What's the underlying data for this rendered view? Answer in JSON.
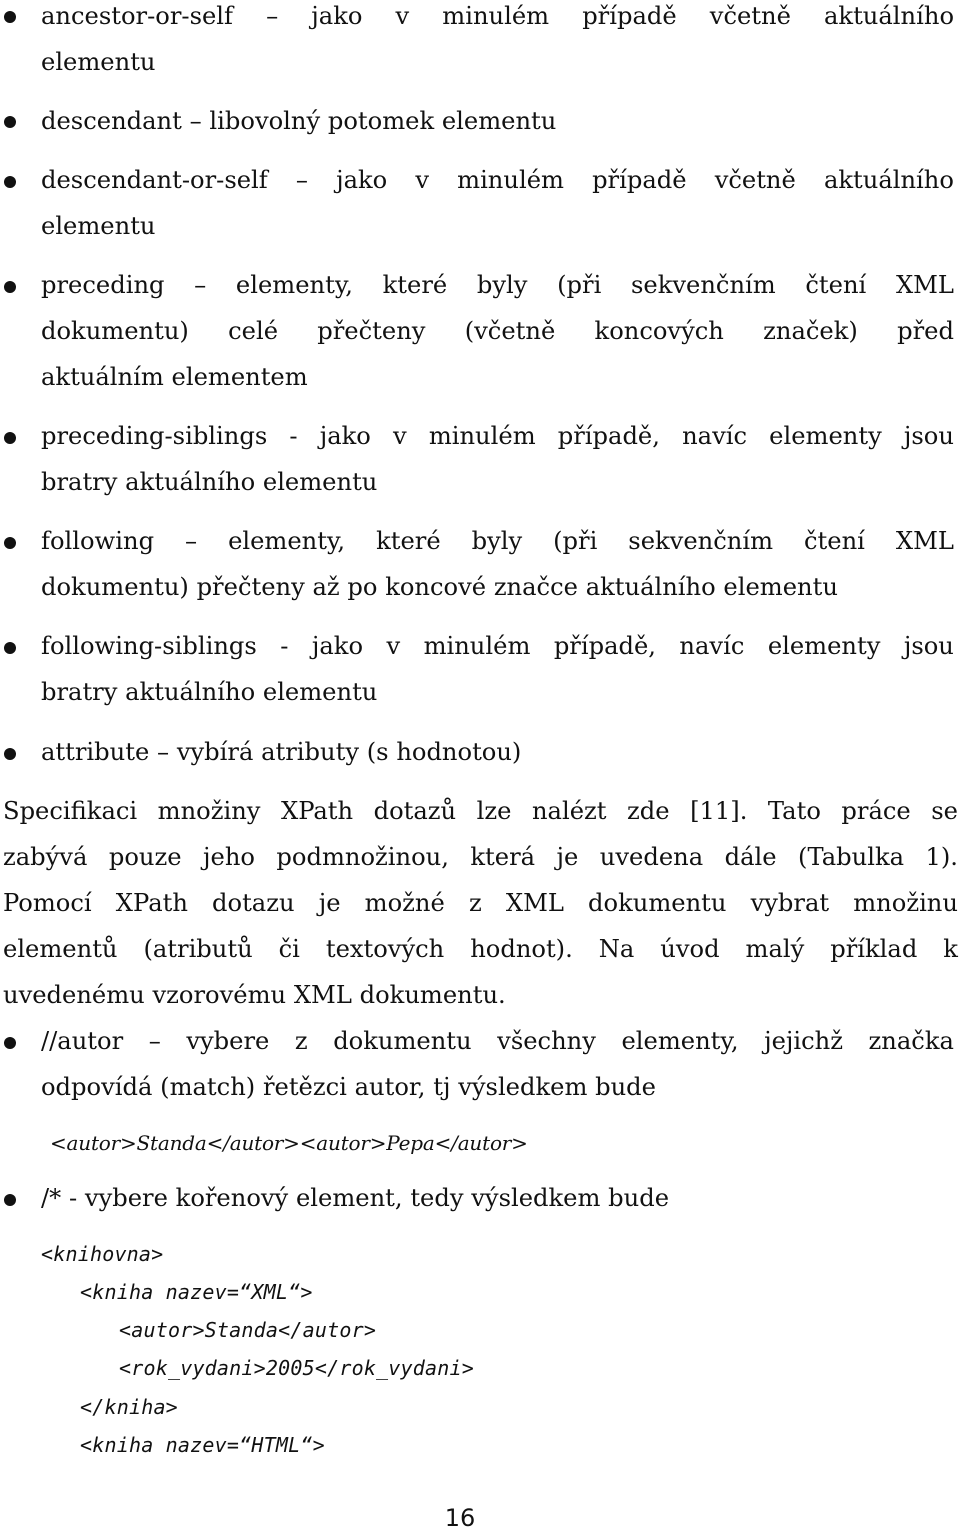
{
  "axes_list": [
    {
      "lines": [
        "ancestor-or-self – jako v minulém případě včetně aktuálního",
        "elementu"
      ]
    },
    {
      "lines": [
        "descendant – libovolný potomek elementu"
      ]
    },
    {
      "lines": [
        "descendant-or-self – jako v minulém případě včetně aktuálního",
        "elementu"
      ]
    },
    {
      "lines": [
        "preceding – elementy, které byly (při sekvenčním čtení XML",
        "dokumentu) celé přečteny (včetně koncových značek) před",
        "aktuálním elementem"
      ]
    },
    {
      "lines": [
        "preceding-siblings - jako v minulém případě, navíc elementy jsou",
        "bratry aktuálního elementu"
      ]
    },
    {
      "lines": [
        "following – elementy, které byly (při sekvenčním čtení XML",
        "dokumentu) přečteny až po koncové značce aktuálního elementu"
      ]
    },
    {
      "lines": [
        "following-siblings - jako v minulém případě, navíc elementy jsou",
        "bratry aktuálního elementu"
      ]
    },
    {
      "lines": [
        "attribute – vybírá atributy (s hodnotou)"
      ]
    }
  ],
  "paragraph": {
    "lines": [
      "Specifikaci množiny XPath dotazů lze nalézt zde [11]. Tato práce se",
      "zabývá pouze jeho podmnožinou, která je uvedena dále (Tabulka 1).",
      "Pomocí XPath dotazu je možné z XML dokumentu vybrat množinu",
      "elementů (atributů či textových hodnot). Na úvod malý příklad k",
      "uvedenému vzorovému XML dokumentu."
    ]
  },
  "examples": [
    {
      "lines": [
        "//autor – vybere z dokumentu všechny elementy, jejichž značka",
        "odpovídá (match) řetězci autor, tj výsledkem bude"
      ],
      "result": "<autor>Standa</autor><autor>Pepa</autor>"
    },
    {
      "lines": [
        "/* - vybere kořenový element, tedy výsledkem bude"
      ]
    }
  ],
  "code_block": [
    {
      "indent": 0,
      "text": "<knihovna>"
    },
    {
      "indent": 1,
      "text": "<kniha nazev=“XML“>"
    },
    {
      "indent": 2,
      "text": "<autor>Standa</autor>"
    },
    {
      "indent": 2,
      "text": "<rok_vydani>2005</rok_vydani>"
    },
    {
      "indent": 1,
      "text": "</kniha>"
    },
    {
      "indent": 1,
      "text": "<kniha nazev=“HTML“>"
    }
  ],
  "page_number": "16"
}
